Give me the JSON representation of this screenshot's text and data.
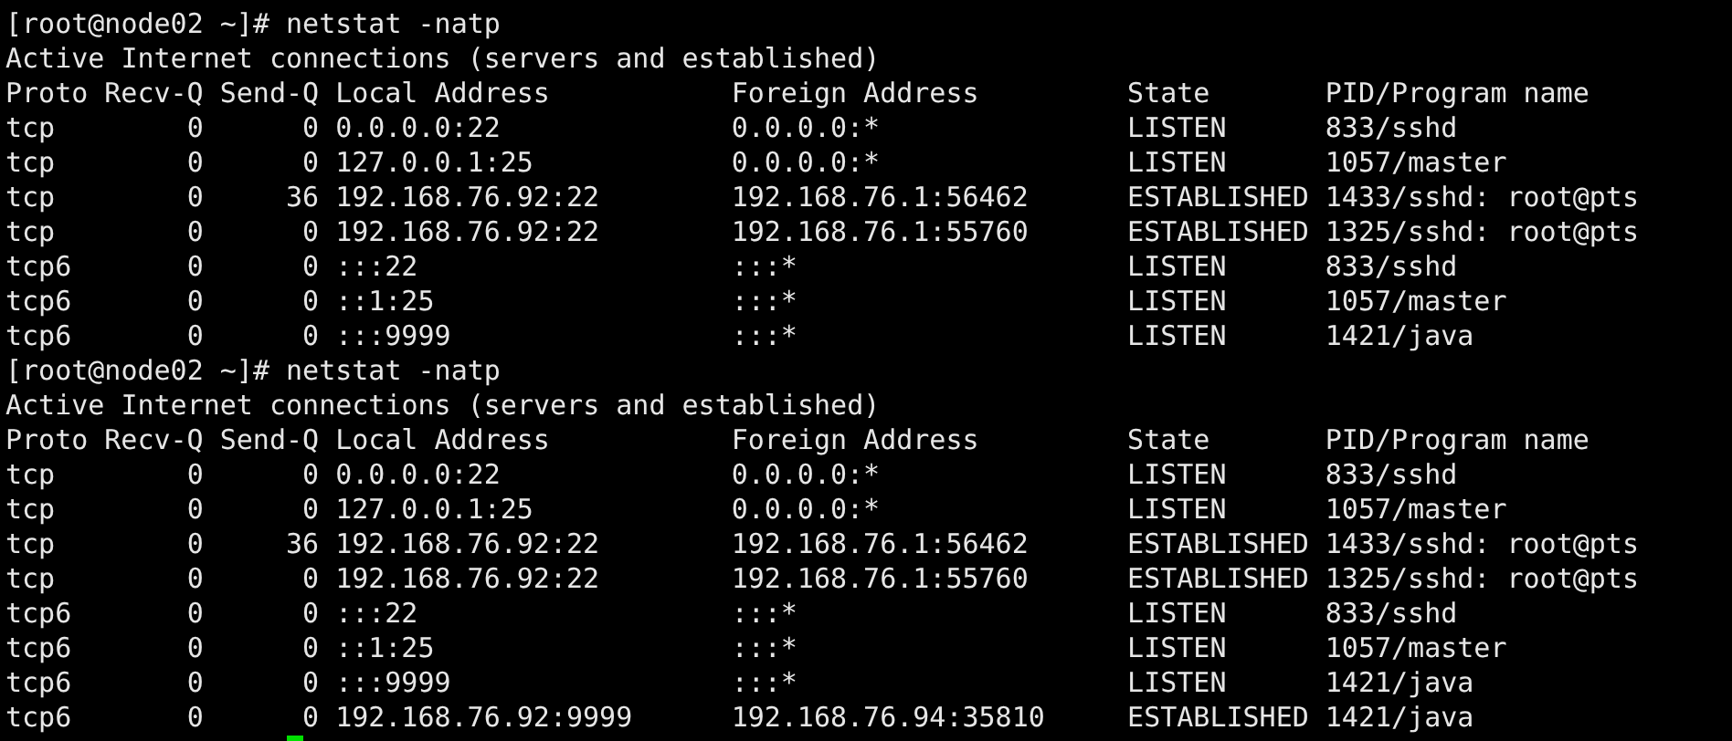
{
  "terminal": {
    "sessions": [
      {
        "prompt": "[root@node02 ~]#",
        "command": "netstat -natp",
        "title": "Active Internet connections (servers and established)",
        "columns": [
          "Proto",
          "Recv-Q",
          "Send-Q",
          "Local Address",
          "Foreign Address",
          "State",
          "PID/Program name"
        ],
        "rows": [
          [
            "tcp",
            "0",
            "0",
            "0.0.0.0:22",
            "0.0.0.0:*",
            "LISTEN",
            "833/sshd"
          ],
          [
            "tcp",
            "0",
            "0",
            "127.0.0.1:25",
            "0.0.0.0:*",
            "LISTEN",
            "1057/master"
          ],
          [
            "tcp",
            "0",
            "36",
            "192.168.76.92:22",
            "192.168.76.1:56462",
            "ESTABLISHED",
            "1433/sshd: root@pts"
          ],
          [
            "tcp",
            "0",
            "0",
            "192.168.76.92:22",
            "192.168.76.1:55760",
            "ESTABLISHED",
            "1325/sshd: root@pts"
          ],
          [
            "tcp6",
            "0",
            "0",
            ":::22",
            ":::*",
            "LISTEN",
            "833/sshd"
          ],
          [
            "tcp6",
            "0",
            "0",
            "::1:25",
            ":::*",
            "LISTEN",
            "1057/master"
          ],
          [
            "tcp6",
            "0",
            "0",
            ":::9999",
            ":::*",
            "LISTEN",
            "1421/java"
          ]
        ]
      },
      {
        "prompt": "[root@node02 ~]#",
        "command": "netstat -natp",
        "title": "Active Internet connections (servers and established)",
        "columns": [
          "Proto",
          "Recv-Q",
          "Send-Q",
          "Local Address",
          "Foreign Address",
          "State",
          "PID/Program name"
        ],
        "rows": [
          [
            "tcp",
            "0",
            "0",
            "0.0.0.0:22",
            "0.0.0.0:*",
            "LISTEN",
            "833/sshd"
          ],
          [
            "tcp",
            "0",
            "0",
            "127.0.0.1:25",
            "0.0.0.0:*",
            "LISTEN",
            "1057/master"
          ],
          [
            "tcp",
            "0",
            "36",
            "192.168.76.92:22",
            "192.168.76.1:56462",
            "ESTABLISHED",
            "1433/sshd: root@pts"
          ],
          [
            "tcp",
            "0",
            "0",
            "192.168.76.92:22",
            "192.168.76.1:55760",
            "ESTABLISHED",
            "1325/sshd: root@pts"
          ],
          [
            "tcp6",
            "0",
            "0",
            ":::22",
            ":::*",
            "LISTEN",
            "833/sshd"
          ],
          [
            "tcp6",
            "0",
            "0",
            "::1:25",
            ":::*",
            "LISTEN",
            "1057/master"
          ],
          [
            "tcp6",
            "0",
            "0",
            ":::9999",
            ":::*",
            "LISTEN",
            "1421/java"
          ],
          [
            "tcp6",
            "0",
            "0",
            "192.168.76.92:9999",
            "192.168.76.94:35810",
            "ESTABLISHED",
            "1421/java"
          ]
        ]
      }
    ],
    "cursor": true
  }
}
